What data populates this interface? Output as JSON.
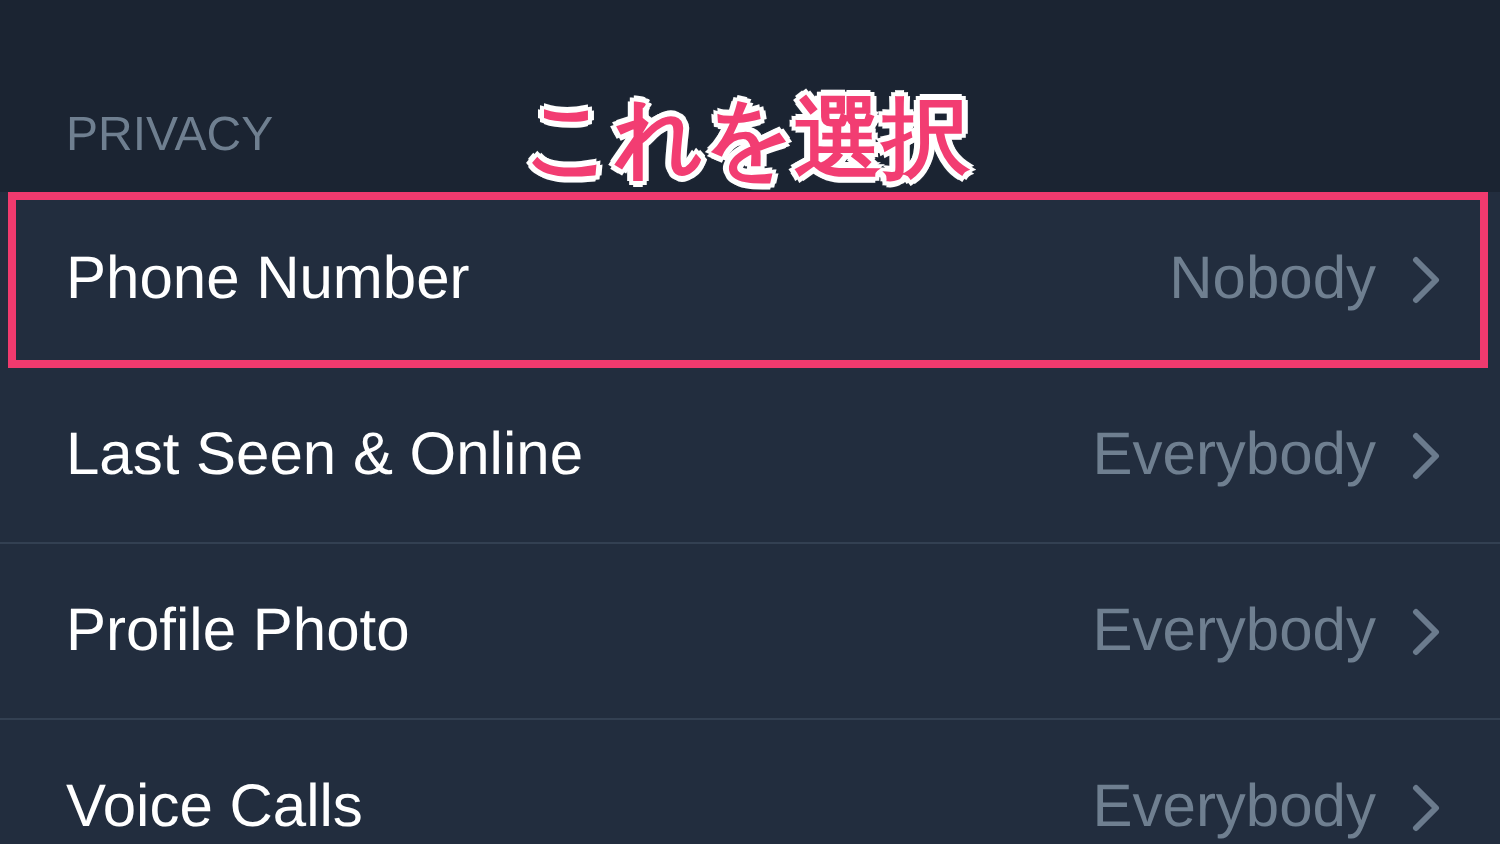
{
  "section_header": "PRIVACY",
  "annotation": {
    "text": "これを選択"
  },
  "rows": [
    {
      "label": "Phone Number",
      "value": "Nobody",
      "highlighted": true
    },
    {
      "label": "Last Seen & Online",
      "value": "Everybody",
      "highlighted": false
    },
    {
      "label": "Profile Photo",
      "value": "Everybody",
      "highlighted": false
    },
    {
      "label": "Voice Calls",
      "value": "Everybody",
      "highlighted": false
    }
  ]
}
